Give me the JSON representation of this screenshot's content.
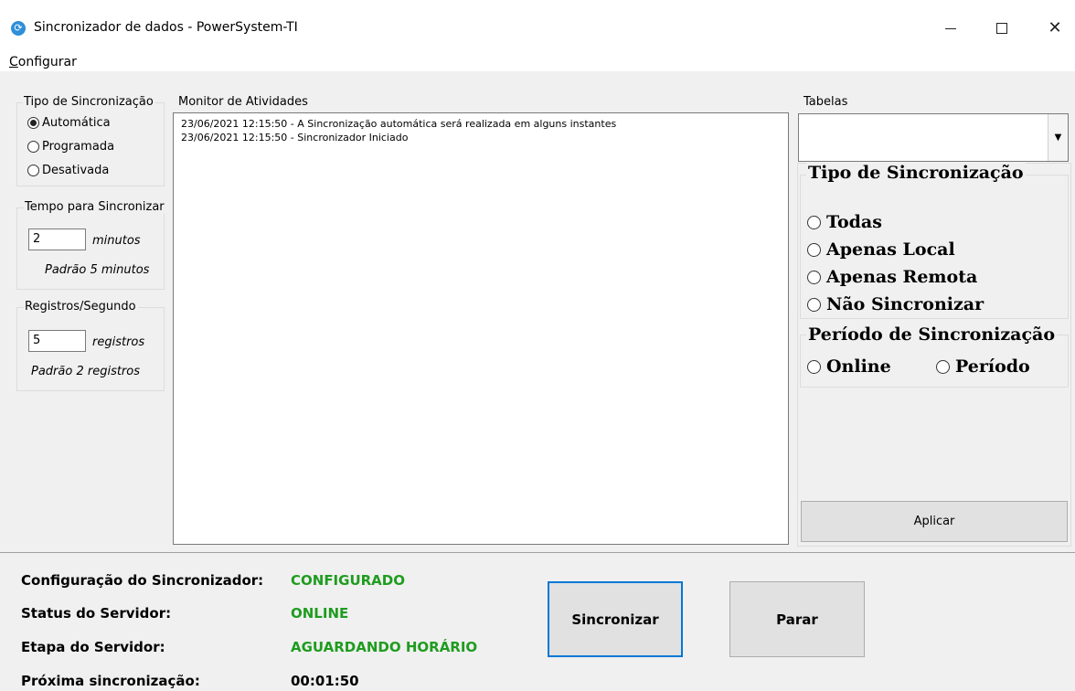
{
  "window": {
    "title": "Sincronizador de dados - PowerSystem-TI",
    "app_icon_glyph": "⟳"
  },
  "menu": {
    "configurar_first": "C",
    "configurar_rest": "onfigurar"
  },
  "sync_type": {
    "legend": "Tipo de Sincronização",
    "options": [
      "Automática",
      "Programada",
      "Desativada"
    ],
    "selected": "Automática"
  },
  "sync_time": {
    "legend": "Tempo para Sincronizar",
    "value": "2",
    "unit": "minutos",
    "hint": "Padrão 5 minutos"
  },
  "records": {
    "legend": "Registros/Segundo",
    "value": "5",
    "unit": "registros",
    "hint": "Padrão 2 registros"
  },
  "monitor": {
    "legend": "Monitor de Atividades",
    "lines": [
      "23/06/2021 12:15:50 - A Sincronização automática será realizada em alguns instantes",
      "23/06/2021 12:15:50 - Sincronizador Iniciado"
    ]
  },
  "tables": {
    "legend": "Tabelas",
    "selected": "",
    "sync_type_legend": "Tipo de Sincronização",
    "sync_type_options": [
      "Todas",
      "Apenas Local",
      "Apenas Remota",
      "Não Sincronizar"
    ],
    "period_legend": "Período de Sincronização",
    "period_options": [
      "Online",
      "Período"
    ],
    "apply_label": "Aplicar"
  },
  "status": {
    "config_label": "Configuração do Sincronizador:",
    "config_value": "CONFIGURADO",
    "server_label": "Status do Servidor:",
    "server_value": "ONLINE",
    "stage_label": "Etapa do Servidor:",
    "stage_value": "AGUARDANDO HORÁRIO",
    "next_label": "Próxima sincronização:",
    "next_value": "00:01:50",
    "value_color": "#1f9c1f"
  },
  "buttons": {
    "sync_label": "Sincronizar",
    "stop_label": "Parar"
  }
}
